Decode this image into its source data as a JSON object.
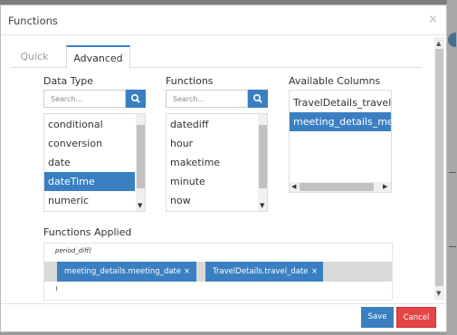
{
  "dialog": {
    "title": "Functions",
    "close_glyph": "×"
  },
  "tabs": [
    {
      "label": "Quick",
      "active": false
    },
    {
      "label": "Advanced",
      "active": true
    }
  ],
  "data_type": {
    "label": "Data Type",
    "search_placeholder": "Search...",
    "items": [
      "conditional",
      "conversion",
      "date",
      "dateTime",
      "numeric"
    ],
    "selected": "dateTime"
  },
  "functions": {
    "label": "Functions",
    "search_placeholder": "Search...",
    "items": [
      "datediff",
      "hour",
      "maketime",
      "minute",
      "now"
    ]
  },
  "available_columns": {
    "label": "Available Columns",
    "items": [
      "TravelDetails_travel_date",
      "meeting_details_meeting_date"
    ],
    "selected": "meeting_details_meeting_date"
  },
  "functions_applied": {
    "label": "Functions Applied",
    "function_open": "period_diff(",
    "chips": [
      {
        "label": "meeting_details.meeting_date",
        "remove": "×"
      },
      {
        "label": "TravelDetails.travel_date",
        "remove": "×"
      }
    ],
    "function_close": ")"
  },
  "footer": {
    "save": "Save",
    "cancel": "Cancel"
  },
  "icons": {
    "search": "search-icon",
    "close": "close-icon"
  },
  "colors": {
    "accent": "#3a7fc1",
    "danger": "#e64545"
  }
}
